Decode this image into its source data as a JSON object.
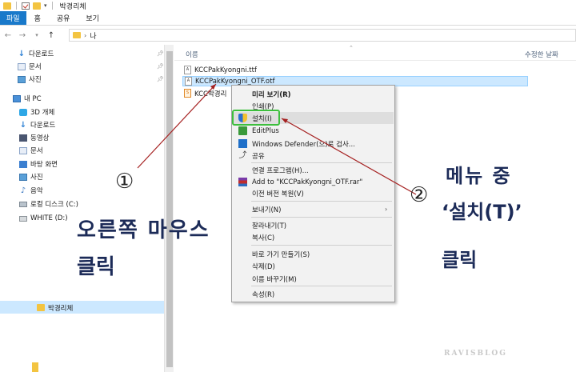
{
  "window": {
    "title": "박경리체"
  },
  "ribbon": {
    "tabs": [
      {
        "label": "파일"
      },
      {
        "label": "홈"
      },
      {
        "label": "공유"
      },
      {
        "label": "보기"
      }
    ]
  },
  "address": {
    "path": "나"
  },
  "nav": {
    "items": [
      {
        "label": "다운로드",
        "icon": "download-icon"
      },
      {
        "label": "문서",
        "icon": "document-icon"
      },
      {
        "label": "사진",
        "icon": "picture-icon"
      },
      {
        "label": "내 PC",
        "icon": "pc-icon"
      },
      {
        "label": "3D 개체",
        "icon": "3d-object-icon"
      },
      {
        "label": "다운로드",
        "icon": "download-icon"
      },
      {
        "label": "동영상",
        "icon": "video-icon"
      },
      {
        "label": "문서",
        "icon": "document-icon"
      },
      {
        "label": "바탕 화면",
        "icon": "desktop-icon"
      },
      {
        "label": "사진",
        "icon": "picture-icon"
      },
      {
        "label": "음악",
        "icon": "music-icon"
      },
      {
        "label": "로컬 디스크 (C:)",
        "icon": "drive-icon"
      },
      {
        "label": "WHITE (D:)",
        "icon": "usb-drive-icon"
      }
    ],
    "selected_folder": "박경리체"
  },
  "filelist": {
    "columns": {
      "name": "이름",
      "date": "수정한 날짜"
    },
    "files": [
      {
        "name": "KCCPakKyongni.ttf",
        "icon_letter": "A"
      },
      {
        "name": "KCCPakKyongni_OTF.otf",
        "icon_letter": "A"
      },
      {
        "name": "KCC박경리",
        "icon_letter": "S"
      }
    ]
  },
  "context_menu": {
    "items": [
      {
        "label": "미리 보기(R)"
      },
      {
        "label": "인쇄(P)"
      },
      {
        "label": "설치(I)"
      },
      {
        "label": "EditPlus"
      },
      {
        "label": "Windows Defender(으)로 검사..."
      },
      {
        "label": "공유"
      },
      {
        "label": "연결 프로그램(H)..."
      },
      {
        "label": "Add to \"KCCPakKyongni_OTF.rar\""
      },
      {
        "label": "이전 버전 복원(V)"
      },
      {
        "label": "보내기(N)"
      },
      {
        "label": "잘라내기(T)"
      },
      {
        "label": "복사(C)"
      },
      {
        "label": "바로 가기 만들기(S)"
      },
      {
        "label": "삭제(D)"
      },
      {
        "label": "이름 바꾸기(M)"
      },
      {
        "label": "속성(R)"
      }
    ]
  },
  "annotations": {
    "num1": "①",
    "num2": "②",
    "note1_line1": "오른쪽 마우스",
    "note1_line2": "클릭",
    "note2_line1": "메뉴 중",
    "note2_line2": "‘설치(T)’",
    "note2_line3": "클릭",
    "highlight_color": "#3dbf3d",
    "arrow_color": "#a52020"
  },
  "watermark": "RAVISBLOG"
}
